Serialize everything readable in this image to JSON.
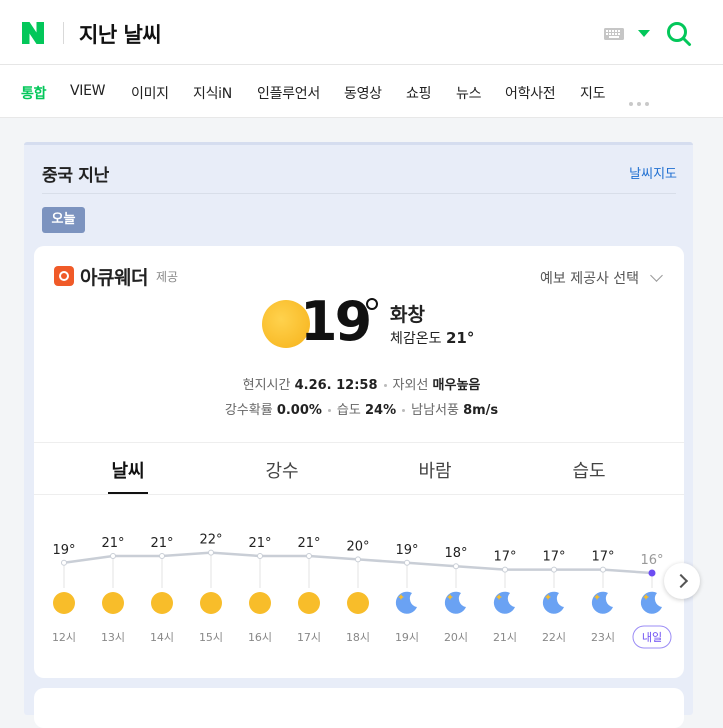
{
  "header": {
    "query": "지난 날씨",
    "colors": {
      "brand": "#03c75a"
    }
  },
  "tabs": [
    {
      "label": "통합",
      "active": true
    },
    {
      "label": "VIEW"
    },
    {
      "label": "이미지"
    },
    {
      "label": "지식iN"
    },
    {
      "label": "인플루언서"
    },
    {
      "label": "동영상"
    },
    {
      "label": "쇼핑"
    },
    {
      "label": "뉴스"
    },
    {
      "label": "어학사전"
    },
    {
      "label": "지도"
    }
  ],
  "panel": {
    "location": "중국 지난",
    "map_link": "날씨지도",
    "today_badge": "오늘"
  },
  "provider": {
    "name": "아큐웨더",
    "tag": "제공",
    "select_label": "예보 제공사 선택"
  },
  "current": {
    "temp": "19",
    "condition": "화창",
    "feels_label": "체감온도",
    "feels_value": "21°",
    "local_time_label": "현지시간",
    "local_time": "4.26. 12:58",
    "uv_label": "자외선",
    "uv_value": "매우높음",
    "precip_label": "강수확률",
    "precip_value": "0.00%",
    "humidity_label": "습도",
    "humidity_value": "24%",
    "wind_label": "남남서풍",
    "wind_value": "8m/s"
  },
  "weather_tabs": [
    {
      "label": "날씨",
      "active": true
    },
    {
      "label": "강수"
    },
    {
      "label": "바람"
    },
    {
      "label": "습도"
    }
  ],
  "hourly": {
    "temps": [
      "19°",
      "21°",
      "21°",
      "22°",
      "21°",
      "21°",
      "20°",
      "19°",
      "18°",
      "17°",
      "17°",
      "17°",
      "16°"
    ],
    "temp_values": [
      19,
      21,
      21,
      22,
      21,
      21,
      20,
      19,
      18,
      17,
      17,
      17,
      16
    ],
    "icons": [
      "sun-icon",
      "sun-icon",
      "sun-icon",
      "sun-icon",
      "sun-icon",
      "sun-icon",
      "sun-icon",
      "moon-icon",
      "moon-icon",
      "moon-icon",
      "moon-icon",
      "moon-icon",
      "moon-icon"
    ],
    "hours": [
      "12시",
      "13시",
      "14시",
      "15시",
      "16시",
      "17시",
      "18시",
      "19시",
      "20시",
      "21시",
      "22시",
      "23시",
      "내일"
    ]
  }
}
